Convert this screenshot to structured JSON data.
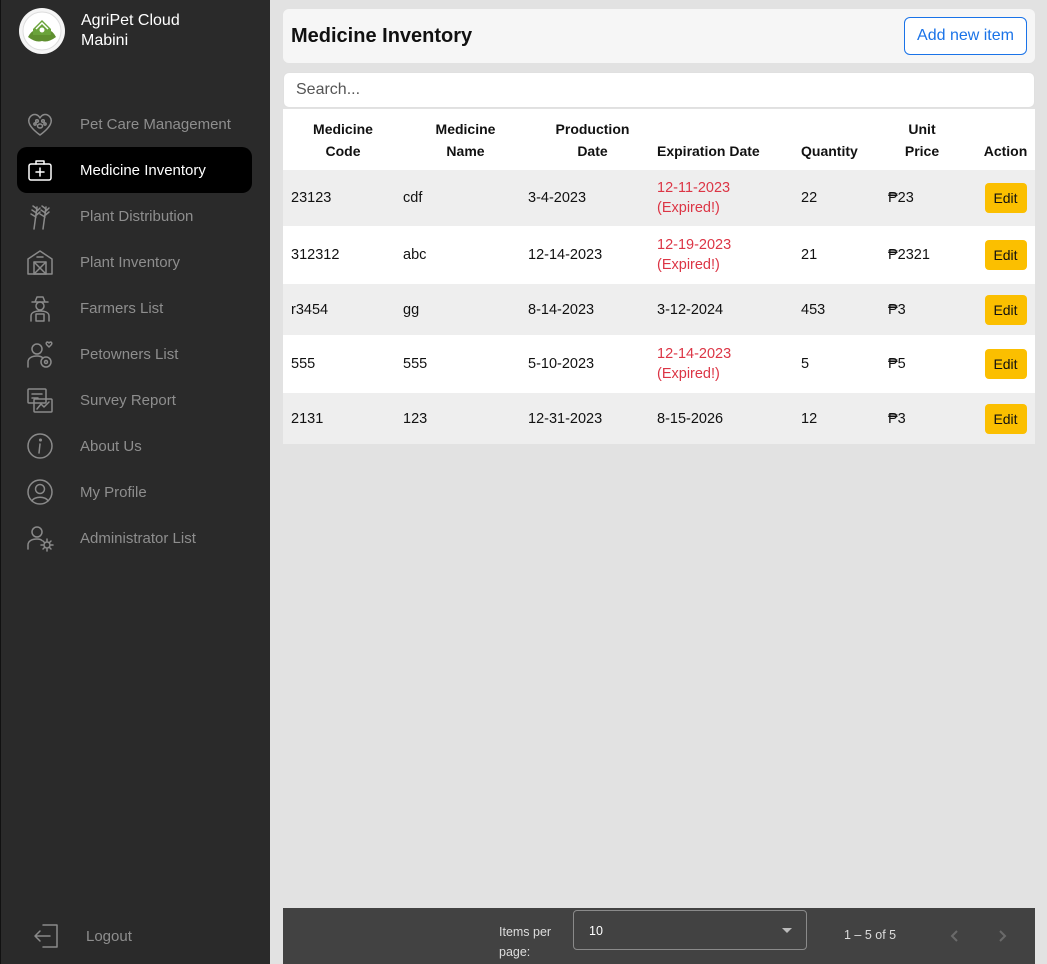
{
  "brand": {
    "line1": "AgriPet Cloud",
    "line2": "Mabini"
  },
  "sidebar": {
    "items": [
      {
        "label": "Pet Care Management",
        "icon": "heart-paw-icon"
      },
      {
        "label": "Medicine Inventory",
        "icon": "medkit-icon",
        "active": true
      },
      {
        "label": "Plant Distribution",
        "icon": "wheat-icon"
      },
      {
        "label": "Plant Inventory",
        "icon": "barn-icon"
      },
      {
        "label": "Farmers List",
        "icon": "farmer-icon"
      },
      {
        "label": "Petowners List",
        "icon": "petowner-icon"
      },
      {
        "label": "Survey Report",
        "icon": "report-chart-icon"
      },
      {
        "label": "About Us",
        "icon": "info-icon"
      },
      {
        "label": "My Profile",
        "icon": "user-circle-icon"
      },
      {
        "label": "Administrator List",
        "icon": "user-gear-icon"
      }
    ],
    "logout": "Logout"
  },
  "header": {
    "title": "Medicine Inventory",
    "add_label": "Add new item"
  },
  "search": {
    "placeholder": "Search..."
  },
  "table": {
    "headers": {
      "code_l1": "Medicine",
      "code_l2": "Code",
      "name_l1": "Medicine",
      "name_l2": "Name",
      "prod_l1": "Production",
      "prod_l2": "Date",
      "exp": "Expiration Date",
      "qty": "Quantity",
      "price_l1": "Unit",
      "price_l2": "Price",
      "action": "Action"
    },
    "rows": [
      {
        "code": "23123",
        "name": "cdf",
        "prod": "3-4-2023",
        "exp": "12-11-2023",
        "expired": "(Expired!)",
        "qty": "22",
        "price": "₱23",
        "edit": "Edit"
      },
      {
        "code": "312312",
        "name": "abc",
        "prod": "12-14-2023",
        "exp": "12-19-2023",
        "expired": "(Expired!)",
        "qty": "21",
        "price": "₱2321",
        "edit": "Edit"
      },
      {
        "code": "r3454",
        "name": "gg",
        "prod": "8-14-2023",
        "exp": "3-12-2024",
        "expired": "",
        "qty": "453",
        "price": "₱3",
        "edit": "Edit"
      },
      {
        "code": "555",
        "name": "555",
        "prod": "5-10-2023",
        "exp": "12-14-2023",
        "expired": "(Expired!)",
        "qty": "5",
        "price": "₱5",
        "edit": "Edit"
      },
      {
        "code": "2131",
        "name": "123",
        "prod": "12-31-2023",
        "exp": "8-15-2026",
        "expired": "",
        "qty": "12",
        "price": "₱3",
        "edit": "Edit"
      }
    ]
  },
  "paginator": {
    "items_per_page_l1": "Items per",
    "items_per_page_l2": "page:",
    "page_size": "10",
    "range": "1 – 5 of 5"
  },
  "colors": {
    "sidebar": "#2a2a2a",
    "active": "#000000",
    "accent": "#1a73e8",
    "expired": "#dc3545",
    "edit": "#fbbf00"
  }
}
